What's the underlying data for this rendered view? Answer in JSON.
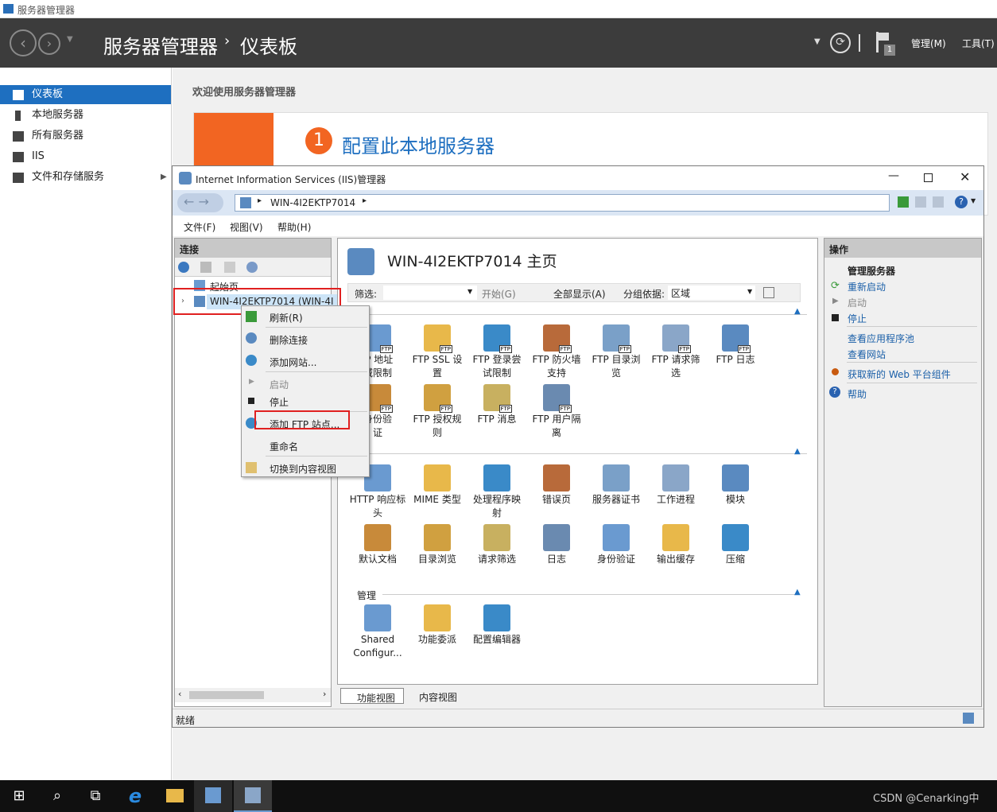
{
  "server_manager": {
    "window_title": "服务器管理器",
    "breadcrumb_root": "服务器管理器",
    "breadcrumb_sep": "›",
    "breadcrumb_page": "仪表板",
    "manage_menu": "管理(M)",
    "tools_menu": "工具(T)",
    "flag_count": "1",
    "welcome": "欢迎使用服务器管理器",
    "quickstart_number": "1",
    "quickstart_title": "配置此本地服务器",
    "sidebar": [
      {
        "label": "仪表板",
        "selected": true
      },
      {
        "label": "本地服务器"
      },
      {
        "label": "所有服务器"
      },
      {
        "label": "IIS"
      },
      {
        "label": "文件和存储服务"
      }
    ]
  },
  "iis": {
    "title": "Internet Information Services (IIS)管理器",
    "address": "WIN-4I2EKTP7014",
    "menu": [
      "文件(F)",
      "视图(V)",
      "帮助(H)"
    ],
    "connections_header": "连接",
    "tree_start": "起始页",
    "tree_server": "WIN-4I2EKTP7014 (WIN-4I",
    "home_title": "WIN-4I2EKTP7014 主页",
    "filter_label": "筛选:",
    "start_label": "开始(G)",
    "show_all_label": "全部显示(A)",
    "group_label": "分组依据:",
    "group_value": "区域",
    "section_manage": "管理",
    "ftp_features": [
      {
        "label": "IP 地址\n域限制",
        "icon": "ftp-ip-icon"
      },
      {
        "label": "FTP SSL 设\n置",
        "icon": "ftp-ssl-icon"
      },
      {
        "label": "FTP 登录尝\n试限制",
        "icon": "ftp-logon-icon"
      },
      {
        "label": "FTP 防火墙\n支持",
        "icon": "ftp-firewall-icon"
      },
      {
        "label": "FTP 目录浏\n览",
        "icon": "ftp-directory-icon"
      },
      {
        "label": "FTP 请求筛\n选",
        "icon": "ftp-request-icon"
      },
      {
        "label": "FTP 日志",
        "icon": "ftp-log-icon"
      },
      {
        "label": "身份验\n证",
        "icon": "ftp-auth-icon"
      },
      {
        "label": "FTP 授权规\n则",
        "icon": "ftp-authz-icon"
      },
      {
        "label": "FTP 消息",
        "icon": "ftp-message-icon"
      },
      {
        "label": "FTP 用户隔\n离",
        "icon": "ftp-isolation-icon"
      }
    ],
    "iis_features": [
      {
        "label": "HTTP 响应标\n头",
        "icon": "http-headers-icon"
      },
      {
        "label": "MIME 类型",
        "icon": "mime-icon"
      },
      {
        "label": "处理程序映\n射",
        "icon": "handler-icon"
      },
      {
        "label": "错误页",
        "icon": "error-page-icon"
      },
      {
        "label": "服务器证书",
        "icon": "certificate-icon"
      },
      {
        "label": "工作进程",
        "icon": "worker-icon"
      },
      {
        "label": "模块",
        "icon": "module-icon"
      },
      {
        "label": "默认文档",
        "icon": "default-doc-icon"
      },
      {
        "label": "目录浏览",
        "icon": "dir-browse-icon"
      },
      {
        "label": "请求筛选",
        "icon": "request-filter-icon"
      },
      {
        "label": "日志",
        "icon": "log-icon"
      },
      {
        "label": "身份验证",
        "icon": "auth-icon"
      },
      {
        "label": "输出缓存",
        "icon": "cache-icon"
      },
      {
        "label": "压缩",
        "icon": "compress-icon"
      }
    ],
    "manage_features": [
      {
        "label": "Shared\nConfigur...",
        "icon": "shared-config-icon"
      },
      {
        "label": "功能委派",
        "icon": "delegation-icon"
      },
      {
        "label": "配置编辑器",
        "icon": "config-editor-icon"
      }
    ],
    "bottom_tabs": [
      "功能视图",
      "内容视图"
    ],
    "status": "就绪",
    "actions_header": "操作",
    "actions_group": "管理服务器",
    "actions": {
      "restart": "重新启动",
      "start": "启动",
      "stop": "停止",
      "app_pools": "查看应用程序池",
      "sites": "查看网站",
      "webpi": "获取新的 Web 平台组件",
      "help": "帮助"
    },
    "context_menu": [
      "刷新(R)",
      "删除连接",
      "添加网站...",
      "启动",
      "停止",
      "添加 FTP 站点...",
      "重命名",
      "切换到内容视图"
    ]
  },
  "watermark": "CSDN @Cenarking中",
  "colors": {
    "accent": "#1e6fc0",
    "orange": "#f26522",
    "highlight_red": "#e02020",
    "sm_header": "#3c3c3c"
  }
}
